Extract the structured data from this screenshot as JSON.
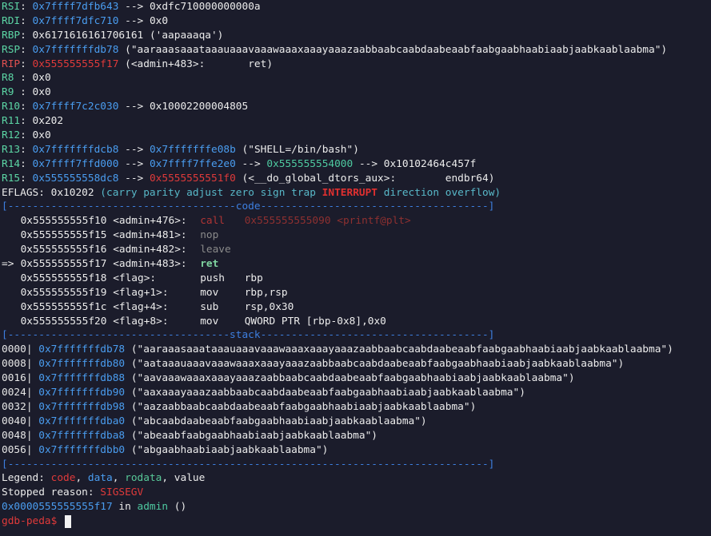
{
  "registers": [
    {
      "name": "RSI",
      "value": "0x7ffff7dfb643",
      "chain": " --> 0xdfc710000000000a",
      "name_color": "green"
    },
    {
      "name": "RDI",
      "value": "0x7ffff7dfc710",
      "chain": " --> 0x0",
      "name_color": "green"
    },
    {
      "name": "RBP",
      "value": "0x6171616161706161",
      "chain": " ('aapaaaqa')",
      "name_color": "green",
      "value_plain": true
    },
    {
      "name": "RSP",
      "value": "0x7fffffffdb78",
      "chain": " (\"aaraaasaaataaauaaavaaawaaaxaaayaaazaabbaabcaabdaabeaabfaabgaabhaabiaabjaabkaablaabma\")",
      "name_color": "green"
    },
    {
      "name": "RIP",
      "value": "0x555555555f17",
      "chain": " (<admin+483>:       ret)",
      "name_color": "red"
    },
    {
      "name": "R8 ",
      "value": "0x0",
      "chain": "",
      "name_color": "green",
      "value_plain": true
    },
    {
      "name": "R9 ",
      "value": "0x0",
      "chain": "",
      "name_color": "green",
      "value_plain": true
    },
    {
      "name": "R10",
      "value": "0x7ffff7c2c030",
      "chain": " --> 0x10002200004805",
      "name_color": "green"
    },
    {
      "name": "R11",
      "value": "0x202",
      "chain": "",
      "name_color": "green",
      "value_plain": true
    },
    {
      "name": "R12",
      "value": "0x0",
      "chain": "",
      "name_color": "green",
      "value_plain": true
    },
    {
      "name": "R13",
      "value": "0x7fffffffdcb8",
      "chain": "",
      "name_color": "green"
    },
    {
      "name": "R14",
      "value": "0x7ffff7ffd000",
      "chain": "",
      "name_color": "green"
    },
    {
      "name": "R15",
      "value": "0x555555558dc8",
      "chain": "",
      "name_color": "green"
    }
  ],
  "r13_chain": {
    "a1": "0x7fffffffe08b",
    "tail": " (\"SHELL=/bin/bash\")"
  },
  "r14_chain": {
    "a1": "0x7ffff7ffe2e0",
    "a2": "0x555555554000",
    "tail": "0x10102464c457f"
  },
  "r15_chain": {
    "a1": "0x5555555551f0",
    "tail": " (<__do_global_dtors_aux>:        endbr64)"
  },
  "eflags": {
    "label": "EFLAGS: 0x10202",
    "open": " (",
    "f1": "carry parity adjust zero sign trap",
    "up": "INTERRUPT",
    "f2": "direction overflow",
    "close": ")"
  },
  "code_header": "[-------------------------------------code-------------------------------------]",
  "code": [
    {
      "addr": "0x555555555f10",
      "sym": "<admin+476>:",
      "mnem": "call",
      "ops": "0x555555555090 <printf@plt>",
      "style": "call"
    },
    {
      "addr": "0x555555555f15",
      "sym": "<admin+481>:",
      "mnem": "nop",
      "ops": "",
      "style": "dim"
    },
    {
      "addr": "0x555555555f16",
      "sym": "<admin+482>:",
      "mnem": "leave",
      "ops": "",
      "style": "dim"
    },
    {
      "addr": "0x555555555f17",
      "sym": "<admin+483>:",
      "mnem": "ret",
      "ops": "",
      "style": "current",
      "arrow": "=> "
    },
    {
      "addr": "0x555555555f18",
      "sym": "<flag>:",
      "mnem": "push",
      "ops": "rbp",
      "style": "normal"
    },
    {
      "addr": "0x555555555f19",
      "sym": "<flag+1>:",
      "mnem": "mov",
      "ops": "rbp,rsp",
      "style": "normal"
    },
    {
      "addr": "0x555555555f1c",
      "sym": "<flag+4>:",
      "mnem": "sub",
      "ops": "rsp,0x30",
      "style": "normal"
    },
    {
      "addr": "0x555555555f20",
      "sym": "<flag+8>:",
      "mnem": "mov",
      "ops": "QWORD PTR [rbp-0x8],0x0",
      "style": "normal"
    }
  ],
  "stack_header": "[------------------------------------stack-------------------------------------]",
  "stack": [
    {
      "off": "0000|",
      "addr": "0x7fffffffdb78",
      "val": " (\"aaraaasaaataaauaaavaaawaaaxaaayaaazaabbaabcaabdaabeaabfaabgaabhaabiaabjaabkaablaabma\")"
    },
    {
      "off": "0008|",
      "addr": "0x7fffffffdb80",
      "val": " (\"aataaauaaavaaawaaaxaaayaaazaabbaabcaabdaabeaabfaabgaabhaabiaabjaabkaablaabma\")"
    },
    {
      "off": "0016|",
      "addr": "0x7fffffffdb88",
      "val": " (\"aavaaawaaaxaaayaaazaabbaabcaabdaabeaabfaabgaabhaabiaabjaabkaablaabma\")"
    },
    {
      "off": "0024|",
      "addr": "0x7fffffffdb90",
      "val": " (\"aaxaaayaaazaabbaabcaabdaabeaabfaabgaabhaabiaabjaabkaablaabma\")"
    },
    {
      "off": "0032|",
      "addr": "0x7fffffffdb98",
      "val": " (\"aazaabbaabcaabdaabeaabfaabgaabhaabiaabjaabkaablaabma\")"
    },
    {
      "off": "0040|",
      "addr": "0x7fffffffdba0",
      "val": " (\"abcaabdaabeaabfaabgaabhaabiaabjaabkaablaabma\")"
    },
    {
      "off": "0048|",
      "addr": "0x7fffffffdba8",
      "val": " (\"abeaabfaabgaabhaabiaabjaabkaablaabma\")"
    },
    {
      "off": "0056|",
      "addr": "0x7fffffffdbb0",
      "val": " (\"abgaabhaabiaabjaabkaablaabma\")"
    }
  ],
  "footer_rule": "[------------------------------------------------------------------------------]",
  "legend": {
    "label": "Legend: ",
    "code": "code",
    "sep1": ", ",
    "data": "data",
    "sep2": ", ",
    "rodata": "rodata",
    "sep3": ", ",
    "value": "value"
  },
  "stopped": {
    "label": "Stopped reason: ",
    "reason": "SIGSEGV"
  },
  "location": {
    "addr": "0x0000555555555f17",
    "in": " in ",
    "func": "admin",
    "tail": " ()"
  },
  "prompt": "gdb-peda$ ",
  "colors": {
    "background": "#1b1c2b",
    "red": "#e03a3a",
    "blue": "#4a9df0",
    "green": "#5cd6a5"
  }
}
